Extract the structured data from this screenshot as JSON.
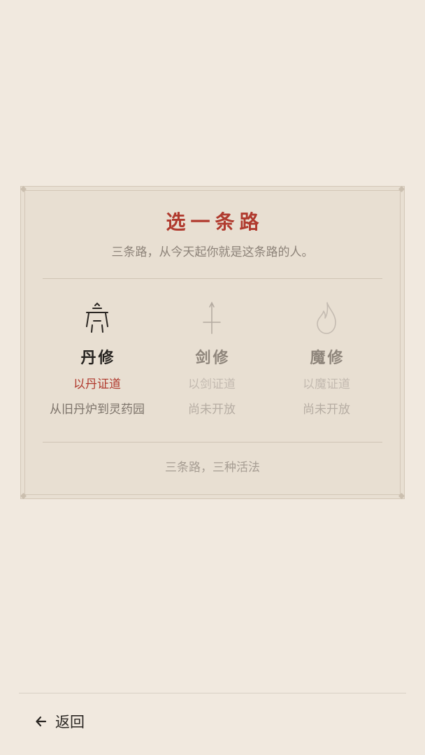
{
  "dialog": {
    "title": "选一条路",
    "subtitle": "三条路，从今天起你就是这条路的人。",
    "footer": "三条路，三种活法"
  },
  "paths": [
    {
      "name": "丹修",
      "motto": "以丹证道",
      "desc": "从旧丹炉到灵药园",
      "icon": "cauldron-icon",
      "enabled": true
    },
    {
      "name": "剑修",
      "motto": "以剑证道",
      "desc": "尚未开放",
      "icon": "sword-icon",
      "enabled": false
    },
    {
      "name": "魔修",
      "motto": "以魔证道",
      "desc": "尚未开放",
      "icon": "flame-icon",
      "enabled": false
    }
  ],
  "nav": {
    "back_label": "返回",
    "back_icon": "arrow-left-icon"
  },
  "colors": {
    "background": "#f1e9df",
    "card": "#e8dfd2",
    "accent": "#b03a2e",
    "text": "#262320",
    "muted": "#8d8379"
  }
}
